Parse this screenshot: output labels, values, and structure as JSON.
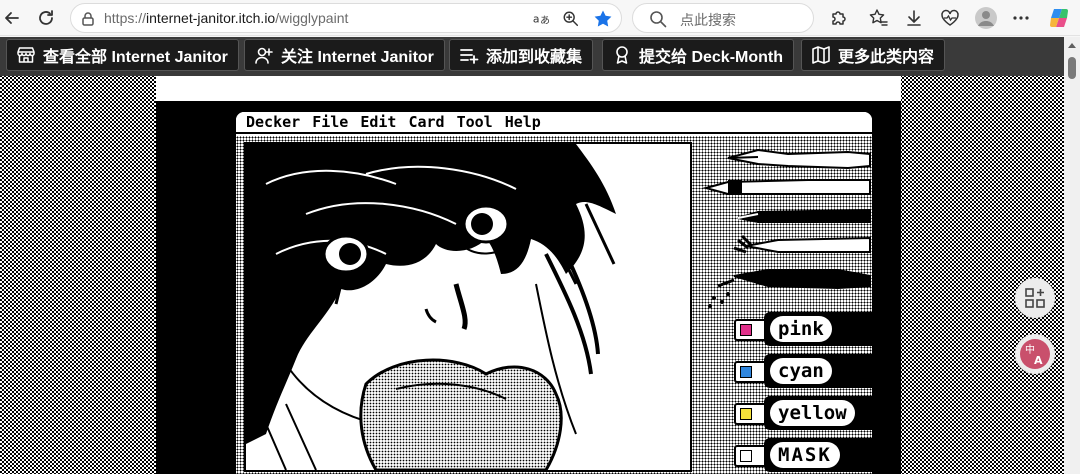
{
  "browser": {
    "url_prefix": "https://",
    "url_host": "internet-janitor.itch.io",
    "url_path": "/wigglypaint",
    "search_placeholder": "点此搜索"
  },
  "icons": {
    "back": "back-arrow-icon",
    "reload": "reload-icon",
    "site_info": "site-info-icon",
    "translate": "translate-icon",
    "zoom": "zoom-in-icon",
    "favorite": "star-filled-icon",
    "search": "search-icon",
    "extensions": "puzzle-icon",
    "favorites": "favorites-list-icon",
    "downloads": "download-icon",
    "health": "heart-pulse-icon",
    "profile": "profile-avatar-icon",
    "more": "more-dots-icon",
    "copilot": "copilot-icon"
  },
  "colors": {
    "favorite_star": "#1a73e8",
    "itch_bar": "#3a3a3a",
    "itch_button": "#1b1b1b",
    "marker_pink": "#e0308a",
    "marker_cyan": "#2f86de",
    "marker_yellow": "#f5e23a"
  },
  "itch_toolbar": {
    "buttons": [
      {
        "label": "查看全部 Internet Janitor",
        "icon": "store-icon"
      },
      {
        "label": "关注 Internet Janitor",
        "icon": "follow-user-icon"
      },
      {
        "label": "添加到收藏集",
        "icon": "add-to-collection-icon"
      },
      {
        "label": "提交给 Deck-Month",
        "icon": "award-ribbon-icon"
      },
      {
        "label": "更多此类内容",
        "icon": "map-icon"
      }
    ]
  },
  "decker": {
    "menu": [
      "Decker",
      "File",
      "Edit",
      "Card",
      "Tool",
      "Help"
    ],
    "markers": [
      {
        "label": "pink",
        "color": "#e0308a"
      },
      {
        "label": "cyan",
        "color": "#2f86de"
      },
      {
        "label": "yellow",
        "color": "#f5e23a"
      },
      {
        "label": "MASK",
        "color": "#ffffff"
      }
    ]
  }
}
